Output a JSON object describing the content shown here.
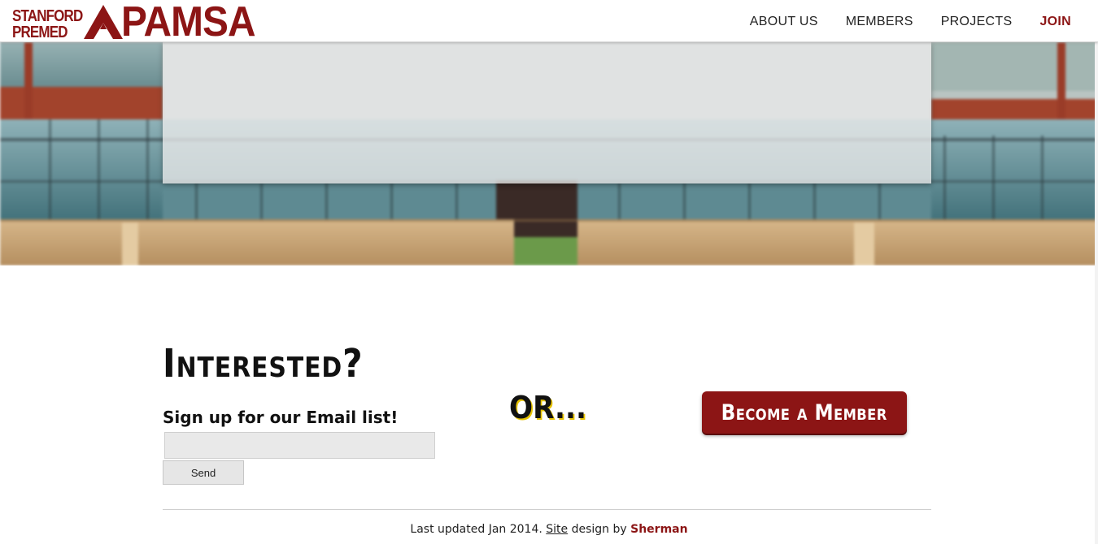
{
  "brand": {
    "logo_line1": "STANFORD",
    "logo_line2": "PREMED",
    "logo_word": "PAMSA",
    "accent_color": "#8c1515"
  },
  "nav": {
    "items": [
      {
        "label": "ABOUT US"
      },
      {
        "label": "MEMBERS"
      },
      {
        "label": "PROJECTS"
      },
      {
        "label": "JOIN"
      }
    ]
  },
  "interest": {
    "title": "Interested?",
    "signup_label": "Sign up for our Email list!",
    "email_value": "",
    "send_label": "Send",
    "or_text": "OR...",
    "member_button_label": "Become a Member"
  },
  "footer": {
    "prefix": "Last updated Jan 2014. ",
    "site_link": "Site",
    "middle": " design by ",
    "author": "Sherman"
  }
}
